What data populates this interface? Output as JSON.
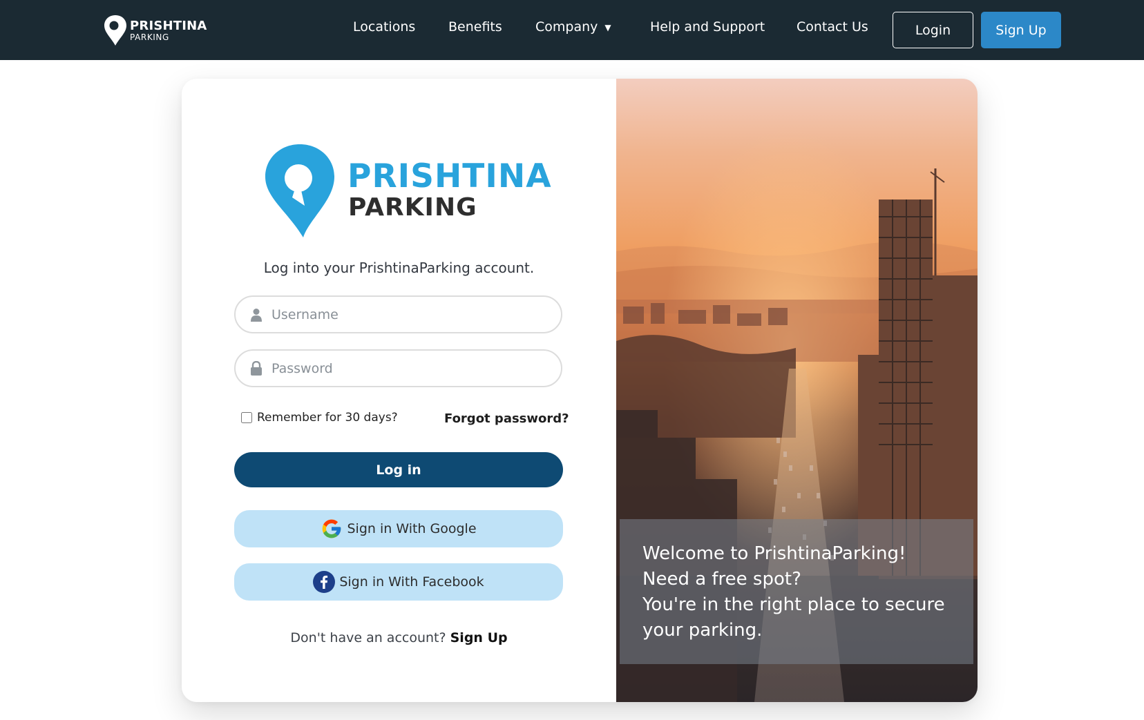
{
  "navbar": {
    "logo_line1": "PRISHTINA",
    "logo_line2": "PARKING",
    "links": [
      "Locations",
      "Benefits",
      "Company",
      "Help and Support",
      "Contact Us"
    ],
    "login_label": "Login",
    "signup_label": "Sign Up"
  },
  "brand": {
    "name": "PRISHTINA",
    "sub": "PARKING"
  },
  "form": {
    "subtitle": "Log into your PrishtinaParking account.",
    "username_placeholder": "Username",
    "password_placeholder": "Password",
    "remember_label": "Remember for 30 days?",
    "forgot_label": "Forgot password?",
    "login_button": "Log in",
    "google_button": "Sign in With Google",
    "facebook_button": "Sign in With Facebook",
    "no_account_text": "Don't have an account?",
    "signup_link": "Sign Up"
  },
  "hero": {
    "welcome_lines": [
      "Welcome to PrishtinaParking!",
      "Need a free spot?",
      "You're in the right place to secure",
      "your parking."
    ]
  },
  "colors": {
    "navbar_bg": "#1b2a33",
    "brand_blue": "#29a3dc",
    "login_button": "#0e4a73",
    "social_button": "#bfe2f7",
    "signup_nav_button": "#2c88c8"
  },
  "icons": {
    "username": "user-icon",
    "password": "lock-icon",
    "google": "google-icon",
    "facebook": "facebook-icon",
    "company_caret": "caret-down-icon"
  }
}
